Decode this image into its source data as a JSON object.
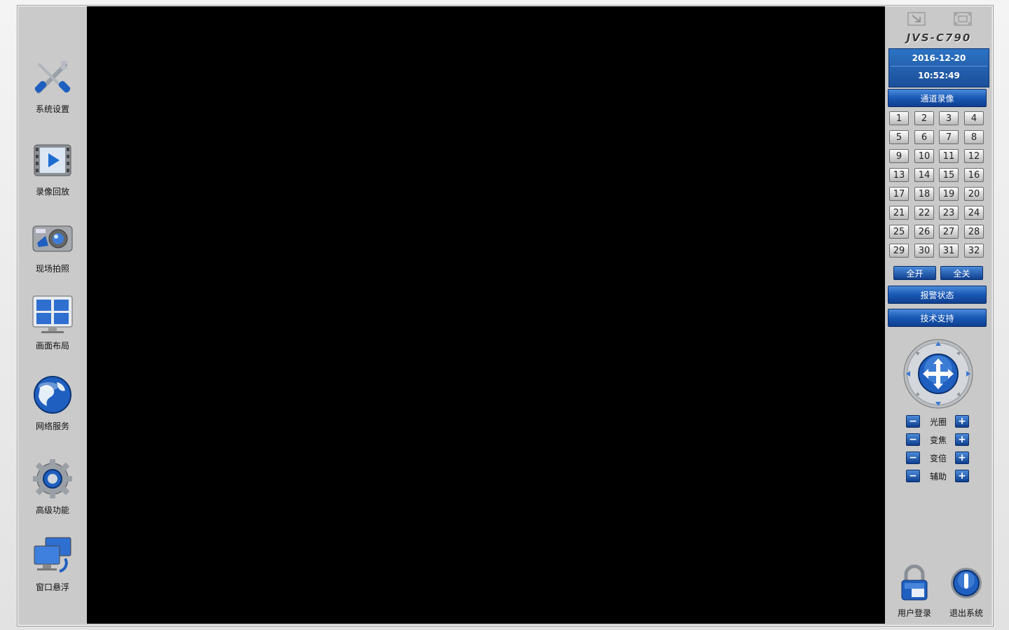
{
  "sidebar": {
    "items": [
      {
        "label": "系统设置",
        "icon": "tools-icon"
      },
      {
        "label": "录像回放",
        "icon": "film-play-icon"
      },
      {
        "label": "现场拍照",
        "icon": "camera-icon"
      },
      {
        "label": "画面布局",
        "icon": "layout-grid-icon"
      },
      {
        "label": "网络服务",
        "icon": "globe-icon"
      },
      {
        "label": "高级功能",
        "icon": "gear-icon"
      },
      {
        "label": "窗口悬浮",
        "icon": "monitors-icon"
      }
    ]
  },
  "right_panel": {
    "brand": "JVS-C790",
    "date": "2016-12-20",
    "time": "10:52:49",
    "channel_record_label": "通道录像",
    "channels": [
      "1",
      "2",
      "3",
      "4",
      "5",
      "6",
      "7",
      "8",
      "9",
      "10",
      "11",
      "12",
      "13",
      "14",
      "15",
      "16",
      "17",
      "18",
      "19",
      "20",
      "21",
      "22",
      "23",
      "24",
      "25",
      "26",
      "27",
      "28",
      "29",
      "30",
      "31",
      "32"
    ],
    "all_on_label": "全开",
    "all_off_label": "全关",
    "alarm_status_label": "报警状态",
    "tech_support_label": "技术支持",
    "ptz_controls": [
      {
        "label": "光圈",
        "minus": "−",
        "plus": "+"
      },
      {
        "label": "变焦",
        "minus": "−",
        "plus": "+"
      },
      {
        "label": "变倍",
        "minus": "−",
        "plus": "+"
      },
      {
        "label": "辅助",
        "minus": "−",
        "plus": "+"
      }
    ],
    "user_login_label": "用户登录",
    "exit_label": "退出系统"
  },
  "colors": {
    "accent_blue": "#1a59b5",
    "panel_gray": "#c9c9c9",
    "video_bg": "#000000"
  }
}
